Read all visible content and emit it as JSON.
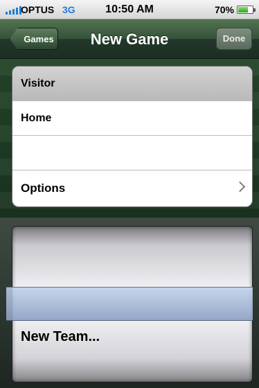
{
  "status_bar": {
    "carrier": "OPTUS",
    "network": "3G",
    "time": "10:50 AM",
    "battery_percent": "70%",
    "battery_level": 0.7
  },
  "nav": {
    "title": "New Game",
    "back_label": "Games",
    "done_label": "Done"
  },
  "table": {
    "rows": [
      {
        "label": "Visitor",
        "selected": true
      },
      {
        "label": "Home"
      },
      {
        "label": ""
      },
      {
        "label": "Options",
        "disclosure": "chevron-right-icon"
      }
    ]
  },
  "picker": {
    "options": [
      "New Team..."
    ]
  }
}
